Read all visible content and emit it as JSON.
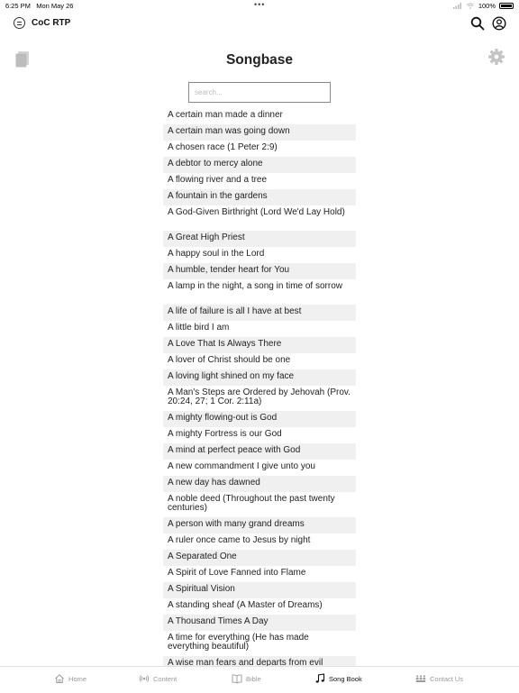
{
  "status": {
    "time": "6:25 PM",
    "date": "Mon May 26",
    "dots": "•••",
    "battery": "100%"
  },
  "app": {
    "title": "CoC RTP"
  },
  "page": {
    "title": "Songbase"
  },
  "search": {
    "placeholder": "search..."
  },
  "songs": [
    "A certain man made a dinner",
    "A certain man was going down",
    "A chosen race (1 Peter 2:9)",
    "A debtor to mercy alone",
    "A flowing river and a tree",
    "A fountain in the gardens",
    "A God-Given Birthright (Lord We'd Lay Hold)",
    "A Great High Priest",
    "A happy soul in the Lord",
    "A humble, tender heart for You",
    "A lamp in the night, a song in time of sorrow",
    "A life of failure is all I have at best",
    "A little bird I am",
    "A Love That Is Always There",
    "A lover of Christ should be one",
    "A loving light shined on my face",
    "A Man's Steps are Ordered by Jehovah (Prov. 20:24, 27; 1 Cor. 2:11a)",
    "A mighty flowing-out is God",
    "A mighty Fortress is our God",
    "A mind at perfect peace with God",
    "A new commandment I give unto you",
    "A new day has dawned",
    "A noble deed (Throughout the past twenty centuries)",
    "A person with many grand dreams",
    "A ruler once came to Jesus by night",
    "A Separated One",
    "A Spirit of Love Fanned into Flame",
    "A Spiritual Vision",
    "A standing sheaf (A Master of Dreams)",
    "A Thousand Times A Day",
    "A time for everything (He has made everything beautiful)",
    "A wise man fears and departs from evil"
  ],
  "tabs": {
    "home": "Home",
    "content": "Content",
    "bible": "Bible",
    "songbook": "Song Book",
    "contact": "Contact Us"
  },
  "colors": {
    "active_tab": "#111111",
    "inactive_tab": "#9a9a9a",
    "row_alt": "#f0f0f0"
  }
}
